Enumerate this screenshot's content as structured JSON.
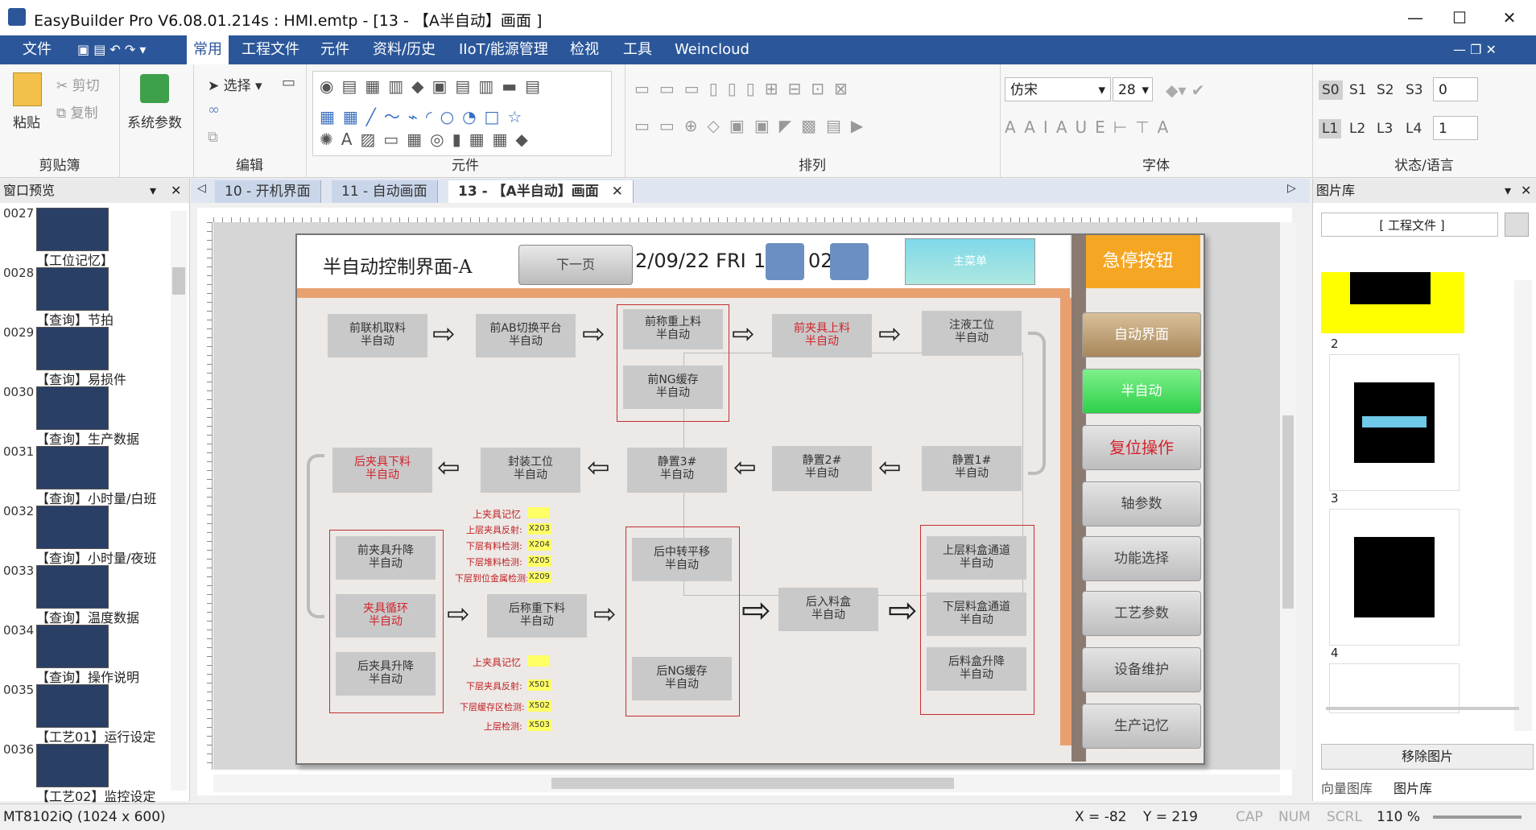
{
  "window": {
    "title": "EasyBuilder Pro V6.08.01.214s : HMI.emtp - [13 - 【A半自动】画面 ]"
  },
  "menu": {
    "items": [
      "文件",
      "常用",
      "工程文件",
      "元件",
      "资料/历史",
      "IIoT/能源管理",
      "检视",
      "工具",
      "Weincloud"
    ]
  },
  "ribbon": {
    "paste": "粘贴",
    "cut": "剪切",
    "copy": "复制",
    "system_params": "系统参数",
    "select": "选择",
    "font_name": "仿宋",
    "font_size": "28",
    "state_labels": [
      "S0",
      "S1",
      "S2",
      "S3"
    ],
    "state_value": "0",
    "lang_labels": [
      "L1",
      "L2",
      "L3",
      "L4"
    ],
    "lang_value": "1",
    "groups": [
      "剪贴簿",
      "编辑",
      "元件",
      "排列",
      "字体",
      "状态/语言"
    ]
  },
  "left_pane": {
    "title": "窗口预览",
    "thumbs": [
      {
        "num": "0027",
        "label": "【工位记忆】"
      },
      {
        "num": "0028",
        "label": "【查询】节拍"
      },
      {
        "num": "0029",
        "label": "【查询】易损件"
      },
      {
        "num": "0030",
        "label": "【查询】生产数据"
      },
      {
        "num": "0031",
        "label": "【查询】小时量/白班"
      },
      {
        "num": "0032",
        "label": "【查询】小时量/夜班"
      },
      {
        "num": "0033",
        "label": "【查询】温度数据"
      },
      {
        "num": "0034",
        "label": "【查询】操作说明"
      },
      {
        "num": "0035",
        "label": "【工艺01】运行设定"
      },
      {
        "num": "0036",
        "label": "【工艺02】监控设定"
      }
    ]
  },
  "tabs": [
    "10 - 开机界面",
    "11 - 自动画面",
    "13 - 【A半自动】画面"
  ],
  "hmi": {
    "title": "半自动控制界面-A",
    "next_page": "下一页",
    "date": "2/09/22 FRI",
    "time_a": "15",
    "time_b": "02",
    "main_menu": "主菜单",
    "estop": "急停按钮",
    "row1": [
      {
        "l1": "前联机取料",
        "l2": "半自动",
        "red": false
      },
      {
        "l1": "前AB切换平台",
        "l2": "半自动",
        "red": false
      },
      {
        "l1": "前称重上料",
        "l2": "半自动",
        "red": false
      },
      {
        "l1": "前夹具上料",
        "l2": "半自动",
        "red": true
      },
      {
        "l1": "注液工位",
        "l2": "半自动",
        "red": false
      }
    ],
    "ng_cache": {
      "l1": "前NG缓存",
      "l2": "半自动"
    },
    "row2": [
      {
        "l1": "后夹具下料",
        "l2": "半自动",
        "red": true
      },
      {
        "l1": "封装工位",
        "l2": "半自动",
        "red": false
      },
      {
        "l1": "静置3#",
        "l2": "半自动",
        "red": false
      },
      {
        "l1": "静置2#",
        "l2": "半自动",
        "red": false
      },
      {
        "l1": "静置1#",
        "l2": "半自动",
        "red": false
      }
    ],
    "row3_left": [
      {
        "l1": "前夹具升降",
        "l2": "半自动",
        "red": false
      },
      {
        "l1": "夹具循环",
        "l2": "半自动",
        "red": true
      },
      {
        "l1": "后夹具升降",
        "l2": "半自动",
        "red": false
      }
    ],
    "rear_weigh": {
      "l1": "后称重下料",
      "l2": "半自动"
    },
    "rear_mid": [
      {
        "l1": "后中转平移",
        "l2": "半自动"
      },
      {
        "l1": "后NG缓存",
        "l2": "半自动"
      }
    ],
    "rear_in": {
      "l1": "后入料盒",
      "l2": "半自动"
    },
    "rear_right": [
      {
        "l1": "上层料盒通道",
        "l2": "半自动"
      },
      {
        "l1": "下层料盒通道",
        "l2": "半自动"
      },
      {
        "l1": "后料盒升降",
        "l2": "半自动"
      }
    ],
    "signals_top": {
      "title": "上夹具记忆",
      "rows": [
        {
          "label": "上层夹具反射:",
          "val": "X203"
        },
        {
          "label": "下层有料检测:",
          "val": "X204"
        },
        {
          "label": "下层堆料检测:",
          "val": "X205"
        },
        {
          "label": "下层到位金属检测:",
          "val": "X209"
        }
      ]
    },
    "signals_bottom": {
      "title": "上夹具记忆",
      "rows": [
        {
          "label": "下层夹具反射:",
          "val": "X501"
        },
        {
          "label": "下层缓存区检测:",
          "val": "X502"
        },
        {
          "label": "上层检测:",
          "val": "X503"
        }
      ]
    },
    "side_buttons": [
      "自动界面",
      "半自动",
      "复位操作",
      "轴参数",
      "功能选择",
      "工艺参数",
      "设备维护",
      "生产记忆"
    ]
  },
  "right_pane": {
    "title": "图片库",
    "dropdown": "[ 工程文件 ]",
    "items": [
      "2",
      "3",
      "4"
    ],
    "remove_button": "移除图片",
    "bottom_tabs": [
      "向量图库",
      "图片库"
    ]
  },
  "status": {
    "device": "MT8102iQ (1024 x 600)",
    "x": "X = -82",
    "y": "Y = 219",
    "cap": "CAP",
    "num": "NUM",
    "scrl": "SCRL",
    "zoom": "110 %"
  },
  "colors": {
    "accent": "#2b579a",
    "estop": "#f5a623",
    "green": "#3ee05a",
    "brown": "#b89a6a"
  }
}
